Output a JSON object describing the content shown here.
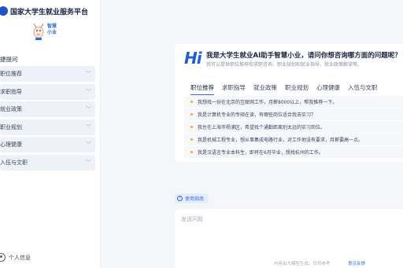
{
  "brand": {
    "title": "国家大学生就业服务平台",
    "logo_icon": "emblem-icon"
  },
  "mascot": {
    "line1": "智慧",
    "line2": "小业",
    "icon": "mascot-icon"
  },
  "sidebar": {
    "section_title": "捷提问",
    "items": [
      {
        "label": "职位推荐"
      },
      {
        "label": "求职指导"
      },
      {
        "label": "就业政策"
      },
      {
        "label": "职业规划"
      },
      {
        "label": "心理健康"
      },
      {
        "label": "入伍与文职"
      }
    ],
    "user_label": "个人信息"
  },
  "welcome": {
    "hi": "Hi",
    "title": "我是大学生就业AI助手智慧小业，请问你想咨询哪方面的问题呢？",
    "subtitle": "我可以提供职位推荐和求职咨询、职业规划和就业指导、就业政策解读等。",
    "tabs": [
      {
        "label": "职位推荐",
        "active": true
      },
      {
        "label": "求职指导",
        "active": false
      },
      {
        "label": "就业政策",
        "active": false
      },
      {
        "label": "职业规划",
        "active": false
      },
      {
        "label": "心理健康",
        "active": false
      },
      {
        "label": "入伍与文职",
        "active": false
      }
    ],
    "questions": [
      "我想找一份在北京的互联网工作，月薪8000以上，帮我推荐一下。",
      "我是计算机专业的专硕在读，有哪些岗位适合我去实习？",
      "我住在上海市杨浦区，希望找个通勤距离别太远的实习岗位。",
      "我是机械工程专业，想从事集成电路行业，对工作地没有要求，月薪要高一点。",
      "我是汉语言专业本科生，即将在6月毕业，想找杭州的工作。"
    ]
  },
  "guide": {
    "label": "使用指南"
  },
  "composer": {
    "placeholder": "发送问题"
  },
  "footer": {
    "disclaimer": "内容由大模型生成，仅供参考",
    "feedback": "意见反馈"
  },
  "colors": {
    "accent": "#2d6cdf",
    "brand": "#1e53c8",
    "bullet": "#f5a623"
  }
}
